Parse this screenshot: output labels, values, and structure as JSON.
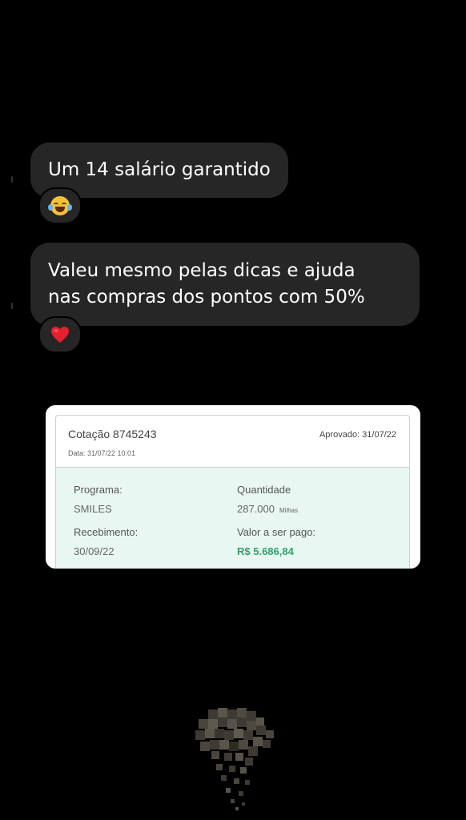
{
  "messages": [
    {
      "text": "Um 14 salário garantido",
      "reaction": "laughing-tears"
    },
    {
      "line1": "Valeu mesmo pelas dicas e ajuda",
      "line2": "nas compras dos pontos com 50%",
      "reaction": "red-heart"
    }
  ],
  "quote_card": {
    "title": "Cotação 8745243",
    "date": "Data: 31/07/22 10:01",
    "approved": "Aprovado: 31/07/22",
    "program_label": "Programa:",
    "program_value": "SMILES",
    "quantity_label": "Quantidade",
    "quantity_value": "287.000",
    "quantity_unit": "Milhas",
    "receipt_label": "Recebimento:",
    "receipt_value": "30/09/22",
    "amount_label": "Valor a ser pago:",
    "amount_value": "R$ 5.686,84"
  },
  "colors": {
    "background": "#000000",
    "bubble": "#262626",
    "card_body": "#e9f7f2",
    "amount_green": "#2fa36b"
  }
}
